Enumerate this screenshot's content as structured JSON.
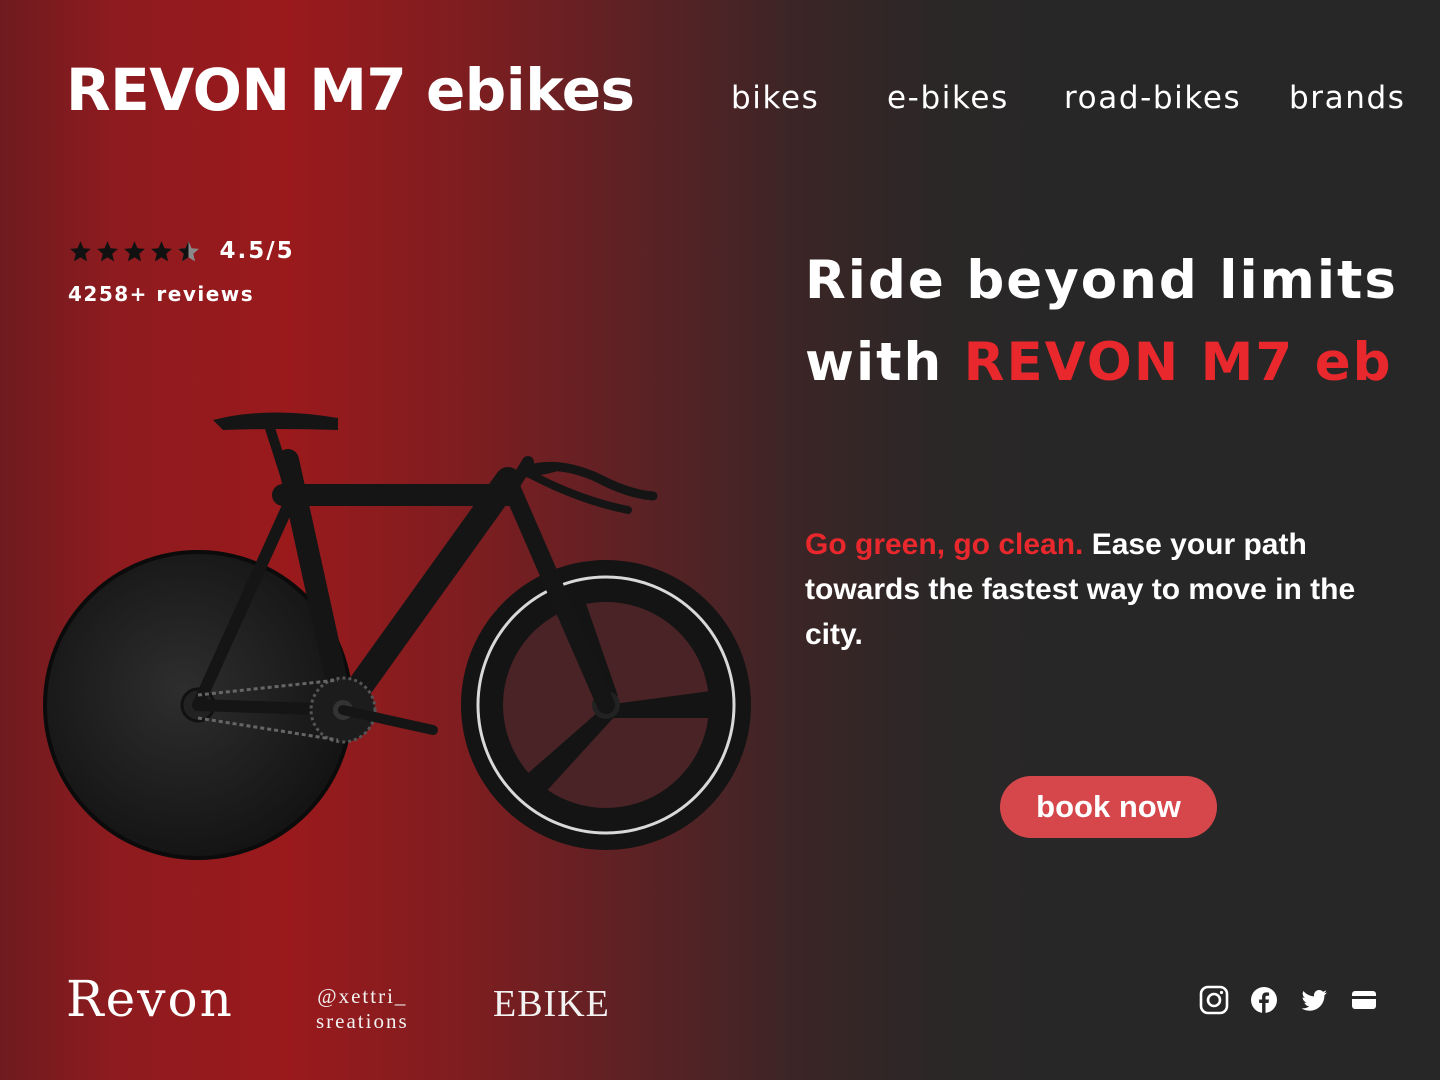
{
  "header": {
    "brand": "REVON M7 ebikes",
    "nav": [
      {
        "label": "bikes"
      },
      {
        "label": "e-bikes"
      },
      {
        "label": "road-bikes"
      },
      {
        "label": "brands"
      }
    ]
  },
  "rating": {
    "stars": 4.5,
    "max": 5,
    "value_text": "4.5/5",
    "reviews_text": "4258+ reviews"
  },
  "hero": {
    "line1": "Ride beyond limits",
    "line2_prefix": "with ",
    "line2_accent": "REVON M7 eb"
  },
  "tagline": {
    "accent": "Go green, go clean.",
    "rest": " Ease your path towards the fastest way to move in the city."
  },
  "cta": {
    "label": "book now"
  },
  "footer": {
    "logo_revon": "Revon",
    "handle_line1": "@xettri_",
    "handle_line2": "sreations",
    "logo_ebike": "EBIKE",
    "socials": [
      {
        "icon": "instagram-icon"
      },
      {
        "icon": "facebook-icon"
      },
      {
        "icon": "twitter-icon"
      },
      {
        "icon": "card-icon"
      }
    ]
  },
  "colors": {
    "accent": "#e8282c",
    "button": "#d6474b",
    "background_dark": "#272727",
    "background_red": "#9a1a1c"
  }
}
